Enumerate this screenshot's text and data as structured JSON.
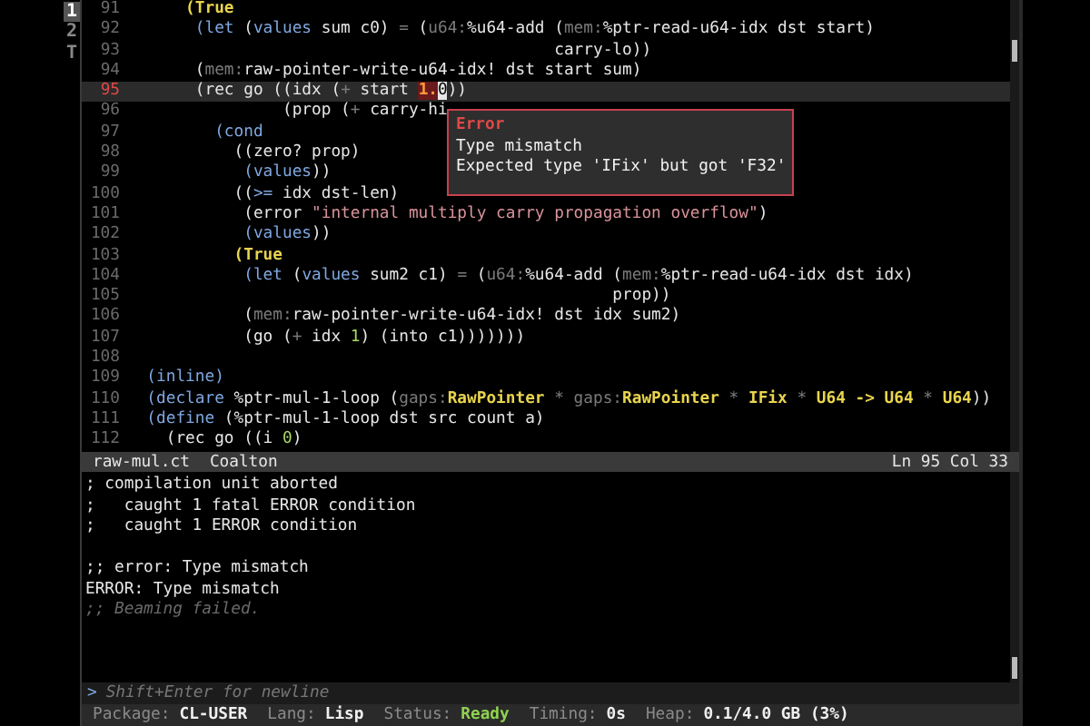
{
  "buffers": [
    {
      "label": "1",
      "selected": true
    },
    {
      "label": "2",
      "selected": false
    },
    {
      "label": "T",
      "selected": false
    }
  ],
  "editor": {
    "lines": [
      {
        "number": "91",
        "current": false,
        "segments": [
          {
            "kind": "t",
            "text": "      (True"
          }
        ]
      },
      {
        "number": "92",
        "current": false,
        "segments": [
          {
            "kind": "k",
            "text": "       (let"
          },
          {
            "kind": "p",
            "text": " ("
          },
          {
            "kind": "k",
            "text": "values"
          },
          {
            "kind": "p",
            "text": " sum c0) "
          },
          {
            "kind": "d",
            "text": "="
          },
          {
            "kind": "p",
            "text": " ("
          },
          {
            "kind": "d",
            "text": "u64:"
          },
          {
            "kind": "p",
            "text": "%u64-add ("
          },
          {
            "kind": "d",
            "text": "mem:"
          },
          {
            "kind": "p",
            "text": "%ptr-read-u64-idx dst start)"
          }
        ]
      },
      {
        "number": "93",
        "current": false,
        "segments": [
          {
            "kind": "p",
            "text": "                                            carry-lo))"
          }
        ]
      },
      {
        "number": "94",
        "current": false,
        "segments": [
          {
            "kind": "p",
            "text": "       ("
          },
          {
            "kind": "d",
            "text": "mem:"
          },
          {
            "kind": "p",
            "text": "raw-pointer-write-u64-idx! dst start sum)"
          }
        ]
      },
      {
        "number": "95",
        "current": true,
        "segments": [
          {
            "kind": "p",
            "text": "       (rec go ((idx ("
          },
          {
            "kind": "d",
            "text": "+"
          },
          {
            "kind": "p",
            "text": " start "
          },
          {
            "kind": "e",
            "text": "1."
          },
          {
            "kind": "c",
            "text": "0"
          },
          {
            "kind": "p",
            "text": "))"
          }
        ]
      },
      {
        "number": "96",
        "current": false,
        "segments": [
          {
            "kind": "p",
            "text": "                (prop ("
          },
          {
            "kind": "d",
            "text": "+"
          },
          {
            "kind": "p",
            "text": " carry-hi"
          }
        ]
      },
      {
        "number": "97",
        "current": false,
        "segments": [
          {
            "kind": "k",
            "text": "         (cond"
          }
        ]
      },
      {
        "number": "98",
        "current": false,
        "segments": [
          {
            "kind": "p",
            "text": "           ((zero? prop)"
          }
        ]
      },
      {
        "number": "99",
        "current": false,
        "segments": [
          {
            "kind": "k",
            "text": "            (values"
          },
          {
            "kind": "p",
            "text": "))"
          }
        ]
      },
      {
        "number": "100",
        "current": false,
        "segments": [
          {
            "kind": "p",
            "text": "           (("
          },
          {
            "kind": "k",
            "text": ">="
          },
          {
            "kind": "p",
            "text": " idx dst-len)"
          }
        ]
      },
      {
        "number": "101",
        "current": false,
        "segments": [
          {
            "kind": "p",
            "text": "            (error "
          },
          {
            "kind": "s",
            "text": "\"internal multiply carry propagation overflow\""
          },
          {
            "kind": "p",
            "text": ")"
          }
        ]
      },
      {
        "number": "102",
        "current": false,
        "segments": [
          {
            "kind": "k",
            "text": "            (values"
          },
          {
            "kind": "p",
            "text": "))"
          }
        ]
      },
      {
        "number": "103",
        "current": false,
        "segments": [
          {
            "kind": "t",
            "text": "           (True"
          }
        ]
      },
      {
        "number": "104",
        "current": false,
        "segments": [
          {
            "kind": "k",
            "text": "            (let"
          },
          {
            "kind": "p",
            "text": " ("
          },
          {
            "kind": "k",
            "text": "values"
          },
          {
            "kind": "p",
            "text": " sum2 c1) "
          },
          {
            "kind": "d",
            "text": "="
          },
          {
            "kind": "p",
            "text": " ("
          },
          {
            "kind": "d",
            "text": "u64:"
          },
          {
            "kind": "p",
            "text": "%u64-add ("
          },
          {
            "kind": "d",
            "text": "mem:"
          },
          {
            "kind": "p",
            "text": "%ptr-read-u64-idx dst idx)"
          }
        ]
      },
      {
        "number": "105",
        "current": false,
        "segments": [
          {
            "kind": "p",
            "text": "                                                  prop))"
          }
        ]
      },
      {
        "number": "106",
        "current": false,
        "segments": [
          {
            "kind": "p",
            "text": "            ("
          },
          {
            "kind": "d",
            "text": "mem:"
          },
          {
            "kind": "p",
            "text": "raw-pointer-write-u64-idx! dst idx sum2)"
          }
        ]
      },
      {
        "number": "107",
        "current": false,
        "segments": [
          {
            "kind": "p",
            "text": "            (go ("
          },
          {
            "kind": "d",
            "text": "+"
          },
          {
            "kind": "p",
            "text": " idx "
          },
          {
            "kind": "n",
            "text": "1"
          },
          {
            "kind": "p",
            "text": ") (into c1)))))))"
          }
        ]
      },
      {
        "number": "108",
        "current": false
      },
      {
        "number": "109",
        "current": false,
        "segments": [
          {
            "kind": "k",
            "text": "  (inline)"
          }
        ]
      },
      {
        "number": "110",
        "current": false,
        "segments": [
          {
            "kind": "k",
            "text": "  (declare"
          },
          {
            "kind": "p",
            "text": " %ptr-mul-1-loop ("
          },
          {
            "kind": "d",
            "text": "gaps:"
          },
          {
            "kind": "t",
            "text": "RawPointer"
          },
          {
            "kind": "d",
            "text": " * gaps:"
          },
          {
            "kind": "t",
            "text": "RawPointer"
          },
          {
            "kind": "d",
            "text": " * "
          },
          {
            "kind": "t",
            "text": "IFix"
          },
          {
            "kind": "d",
            "text": " * "
          },
          {
            "kind": "t",
            "text": "U64 -> U64"
          },
          {
            "kind": "d",
            "text": " * "
          },
          {
            "kind": "t",
            "text": "U64"
          },
          {
            "kind": "p",
            "text": "))"
          }
        ]
      },
      {
        "number": "111",
        "current": false,
        "segments": [
          {
            "kind": "k",
            "text": "  (define"
          },
          {
            "kind": "p",
            "text": " (%ptr-mul-1-loop dst src count a)"
          }
        ]
      },
      {
        "number": "112",
        "current": false,
        "segments": [
          {
            "kind": "p",
            "text": "    (rec go ((i "
          },
          {
            "kind": "n",
            "text": "0"
          },
          {
            "kind": "p",
            "text": ")"
          }
        ]
      }
    ],
    "popup": {
      "title": "Error",
      "lines": [
        "Type mismatch",
        "Expected type 'IFix' but got 'F32'"
      ]
    }
  },
  "mode_line": {
    "file": "raw-mul.ct",
    "mode": "Coalton",
    "position": "Ln 95 Col 33"
  },
  "repl": {
    "lines": [
      {
        "kind": "out",
        "text": "; compilation unit aborted"
      },
      {
        "kind": "out",
        "text": ";   caught 1 fatal ERROR condition"
      },
      {
        "kind": "out",
        "text": ";   caught 1 ERROR condition"
      },
      {
        "kind": "blank"
      },
      {
        "kind": "out",
        "text": ";; error: Type mismatch"
      },
      {
        "kind": "out",
        "text": "ERROR: Type mismatch"
      },
      {
        "kind": "comment",
        "text": ";; Beaming failed."
      }
    ],
    "prompt": ">",
    "placeholder": "Shift+Enter for newline"
  },
  "status_bar": [
    {
      "label": "Package:",
      "value": "CL-USER",
      "kind": "plain"
    },
    {
      "label": "Lang:",
      "value": "Lisp",
      "kind": "plain"
    },
    {
      "label": "Status:",
      "value": "Ready",
      "kind": "ok"
    },
    {
      "label": "Timing:",
      "value": "0s",
      "kind": "plain"
    },
    {
      "label": "Heap:",
      "value": "0.1/4.0 GB (3%)",
      "kind": "plain"
    }
  ]
}
